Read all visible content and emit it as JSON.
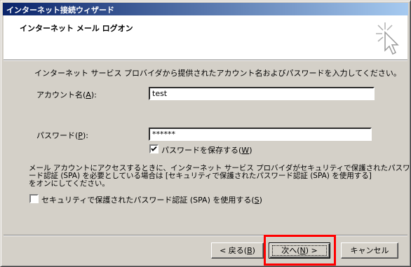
{
  "window": {
    "title": "インターネット接続ウィザード"
  },
  "header": {
    "title": "インターネット メール ログオン",
    "icon": "wizard-sparkle-cursor-icon"
  },
  "intro": "インターネット サービス プロバイダから提供されたアカウント名およびパスワードを入力してください。",
  "account": {
    "label": "アカウント名(",
    "accel": "A",
    "label_end": "):",
    "value": "test"
  },
  "password": {
    "label": "パスワード(",
    "accel": "P",
    "label_end": "):",
    "value": "******"
  },
  "remember": {
    "label": "パスワードを保存する(",
    "accel": "W",
    "label_end": ")",
    "checked": true
  },
  "spa_info": [
    "メール アカウントにアクセスするときに、インターネット サービス プロバイダがセキュリティで保護されたパスワ",
    "ード認証 (SPA) を必要としている場合は [セキュリティで保護されたパスワード認証 (SPA) を使用する]",
    "をオンにしてください。"
  ],
  "spa": {
    "label": "セキュリティで保護されたパスワード認証 (SPA) を使用する(",
    "accel": "S",
    "label_end": ")",
    "checked": false
  },
  "buttons": {
    "back": {
      "label": "< 戻る(",
      "accel": "B",
      "label_end": ")"
    },
    "next": {
      "label": "次へ(",
      "accel": "N",
      "label_end": ") >"
    },
    "cancel": "キャンセル"
  },
  "colors": {
    "highlight": "#ff0000",
    "titlebar_start": "#0a246a",
    "titlebar_end": "#a6caf0"
  }
}
